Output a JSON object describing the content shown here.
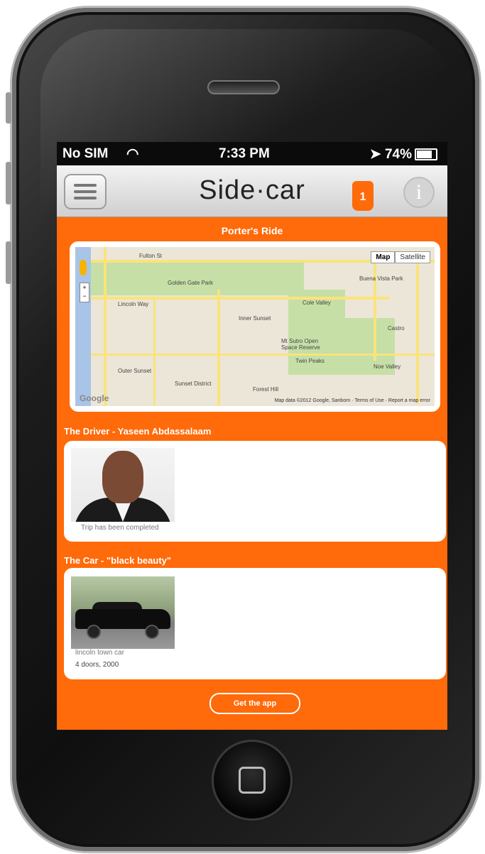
{
  "statusbar": {
    "carrier": "No SIM",
    "time": "7:33 PM",
    "battery": "74%"
  },
  "navbar": {
    "brand": "Side·car",
    "notification_count": "1",
    "info_glyph": "i"
  },
  "ride": {
    "title": "Porter's Ride"
  },
  "map": {
    "map_type_map": "Map",
    "map_type_satellite": "Satellite",
    "labels": [
      "Fulton St",
      "Golden Gate Park",
      "Lincoln Way",
      "Inner Sunset",
      "Cole Valley",
      "Outer Sunset",
      "Sunset District",
      "Twin Peaks",
      "Noe Valley",
      "Forest Hill",
      "Castro",
      "Buena Vista Park",
      "Mt Sutro Open Space Reserve"
    ],
    "footer": "Map data ©2012 Google, Sanborn · Terms of Use · Report a map error",
    "attribution": "Google"
  },
  "driver": {
    "section_title": "The Driver - Yaseen Abdassalaam",
    "status": "Trip has been completed"
  },
  "car": {
    "section_title": "The Car - \"black beauty\"",
    "model": "lincoln town car",
    "details": "4 doors, 2000"
  },
  "cta": {
    "label": "Get the app"
  },
  "colors": {
    "accent": "#ff6a0a",
    "statusbar": "#0b0b0b"
  }
}
